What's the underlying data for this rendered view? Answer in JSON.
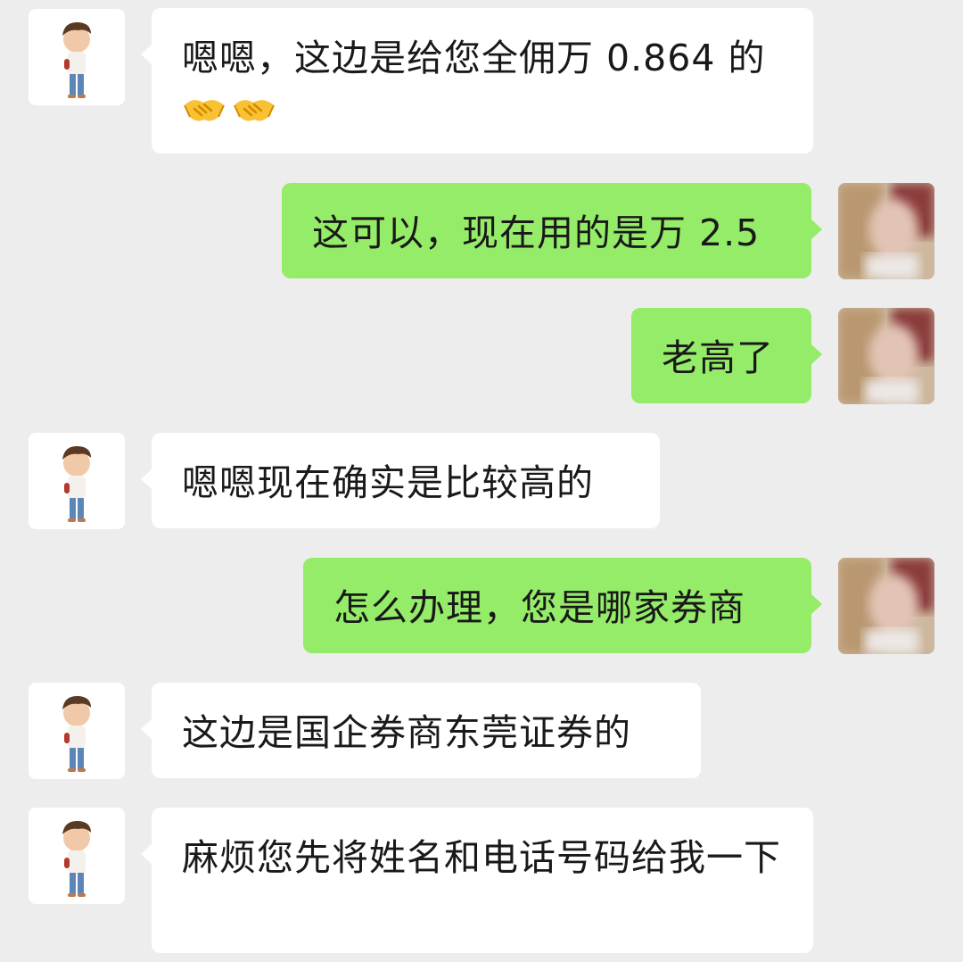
{
  "messages": [
    {
      "side": "left",
      "text": "嗯嗯，这边是给您全佣万 0.864 的",
      "emoji": [
        "handshake-emoji",
        "handshake-emoji"
      ]
    },
    {
      "side": "right",
      "text": "这可以，现在用的是万 2.5"
    },
    {
      "side": "right",
      "text": "老高了"
    },
    {
      "side": "left",
      "text": "嗯嗯现在确实是比较高的"
    },
    {
      "side": "right",
      "text": "怎么办理，您是哪家券商"
    },
    {
      "side": "left",
      "text": "这边是国企券商东莞证券的"
    },
    {
      "side": "left",
      "text": "麻烦您先将姓名和电话号码给我一下"
    }
  ],
  "colors": {
    "background": "#ededed",
    "incoming_bubble": "#ffffff",
    "outgoing_bubble": "#95ec69",
    "text": "#191919"
  },
  "icons": {
    "contact_avatar": "cartoon-boy-avatar",
    "self_avatar": "blurred-photo-avatar",
    "emoji": "handshake-emoji"
  }
}
